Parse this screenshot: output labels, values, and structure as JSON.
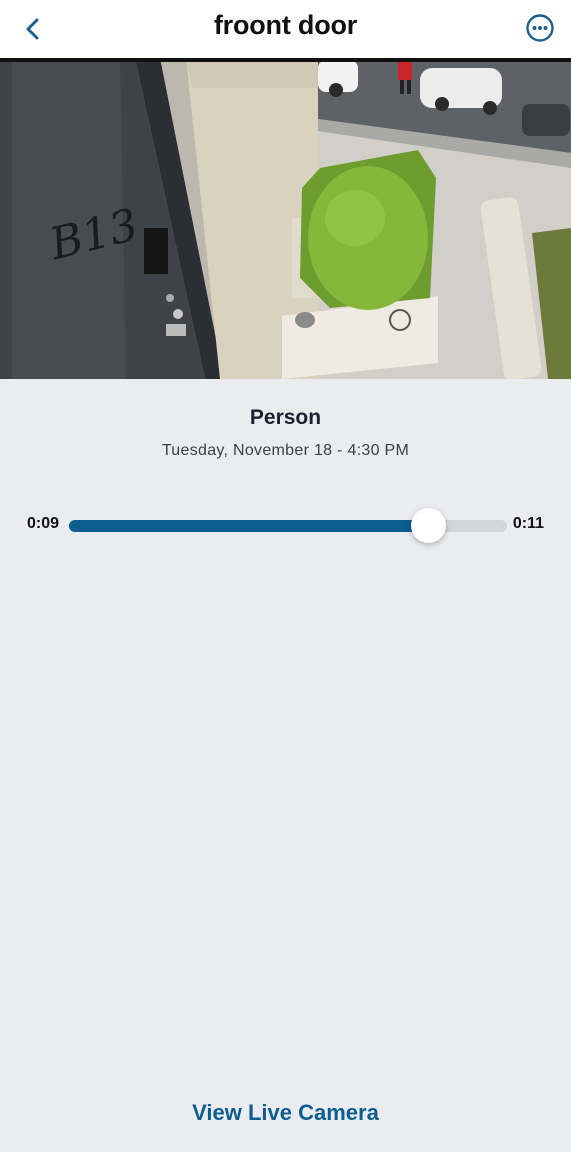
{
  "header": {
    "title": "froont door",
    "back_icon": "chevron-left-icon",
    "more_icon": "ellipsis-circle-icon"
  },
  "video": {
    "door_number": "B13"
  },
  "event": {
    "title": "Person",
    "timestamp": "Tuesday, November 18 - 4:30 PM"
  },
  "playback": {
    "current": "0:09",
    "duration": "0:11",
    "progress_percent": 82
  },
  "actions": {
    "live_camera_label": "View Live Camera"
  },
  "colors": {
    "accent": "#0d5d91",
    "background": "#ebecf0"
  }
}
